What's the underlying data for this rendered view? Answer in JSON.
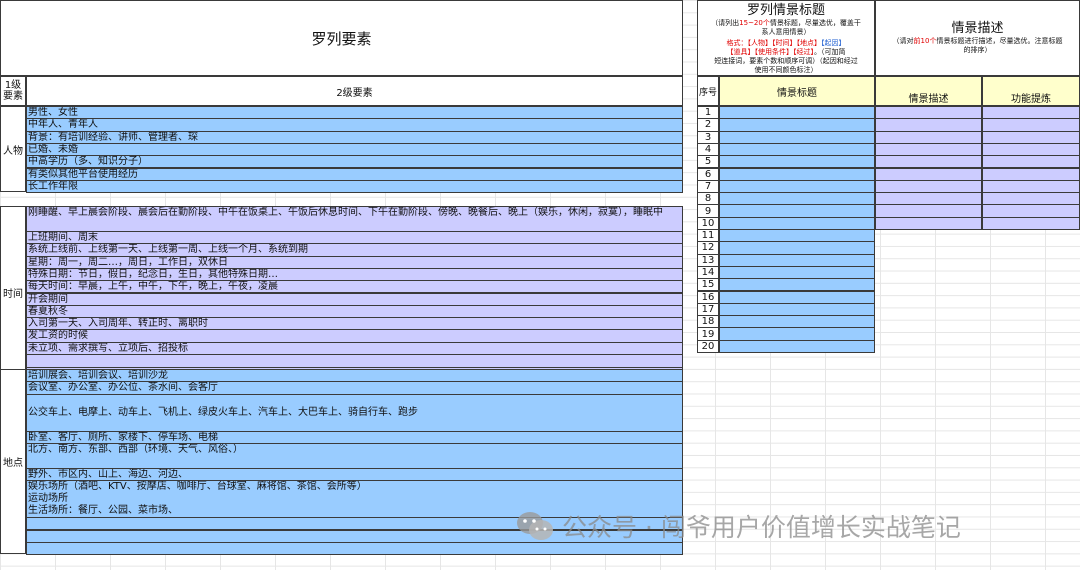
{
  "left_table": {
    "title": "罗列要素",
    "col1_header": "1级\n要素",
    "col2_header": "2级要素",
    "groups": [
      {
        "label": "人物",
        "rows": [
          "男性、女性",
          "中年人、青年人",
          "背景：有培训经验、讲师、管理者、琛",
          "已婚、未婚",
          "中高学历（多、知识分子）",
          "有类似其他平台使用经历",
          "长工作年限"
        ]
      },
      {
        "label": "时间",
        "rows": [
          "刚睡醒、早上晨会阶段、晨会后在勤阶段、中午在饭桌上、午饭后休息时间、下午在勤阶段、傍晚、晚餐后、晚上（娱乐，休闲，寂寞），睡眠中",
          "上班期间、周末",
          "系统上线前、上线第一天、上线第一周、上线一个月、系统到期",
          "星期：周一，周二…，周日，工作日，双休日",
          "特殊日期：节日，假日，纪念日，生日，其他特殊日期…",
          "每天时间：早晨，上午，中午，下午，晚上，午夜，凌晨",
          "开会期间",
          "春夏秋冬",
          "入司第一天、入司周年、转正时、离职时",
          "发工资的时候",
          "未立项、需求撰写、立项后、招投标",
          "",
          ""
        ]
      },
      {
        "label": "地点",
        "rows": [
          "培训展会、培训会议、培训沙龙",
          "会议室、办公室、办公位、茶水间、会客厅",
          "公交车上、电摩上、动车上、飞机上、绿皮火车上、汽车上、大巴车上、骑自行车、跑步",
          "卧室、客厅、厕所、家楼下、停车场、电梯",
          "北方、南方、东部、西部（环境、天气、风俗、）",
          "野外、市区内、山上、海边、河边、",
          "娱乐场所（酒吧、KTV、按摩店、咖啡厅、台球室、麻将馆、茶馆、会所等）\n运动场所\n生活场所：餐厅、公园、菜市场、",
          "",
          "",
          ""
        ]
      }
    ]
  },
  "right_table": {
    "title": "罗列情景标题",
    "instruction_line1_a": "（请列出",
    "instruction_line1_red": "15~20个",
    "instruction_line1_b": "情景标题，尽量选优，覆盖干",
    "instruction_line2": "系人意用情景）",
    "format_label": "格式：",
    "format_tags": "【人物】【时间】【地点】",
    "format_origin": "【起因】",
    "format_tags2": "【道具】【使用条件】【经过】",
    "format_tail": "。（可加简",
    "instruction_line4": "短连接词，要素个数和顺序可调）（起因和经过",
    "instruction_line5": "使用不同颜色标注）",
    "desc_title": "情景描述",
    "desc_instruction_a": "（请对",
    "desc_instruction_red": "前10个",
    "desc_instruction_b": "情景标题进行描述，尽量选优。注意标题",
    "desc_instruction_c": "的排序）",
    "col_index": "序号",
    "col_title": "情景标题",
    "col_desc": "情景描述",
    "col_func": "功能提炼",
    "indices": [
      "1",
      "2",
      "3",
      "4",
      "5",
      "6",
      "7",
      "8",
      "9",
      "10",
      "11",
      "12",
      "13",
      "14",
      "15",
      "16",
      "17",
      "18",
      "19",
      "20"
    ]
  },
  "watermark": {
    "icon": "wechat-icon",
    "text": "公众号 · 闯爷用户价值增长实战笔记"
  }
}
